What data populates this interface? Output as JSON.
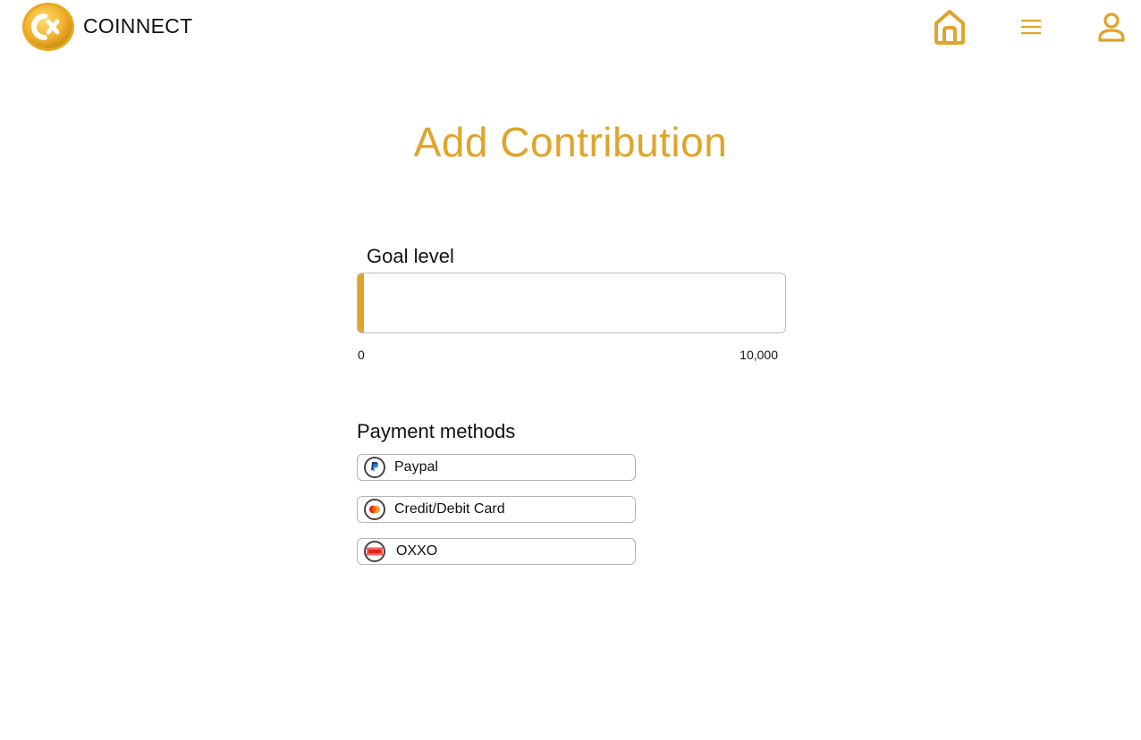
{
  "app": {
    "brand_name": "COINNECT",
    "accent_color": "#e0a42b"
  },
  "nav": {
    "icons": [
      "home-icon",
      "menu-icon",
      "profile-icon"
    ]
  },
  "page": {
    "title": "Add Contribution"
  },
  "goal": {
    "label": "Goal level",
    "min_label": "0",
    "max_label": "10,000",
    "progress_fraction": 0.015
  },
  "payment": {
    "label": "Payment methods",
    "methods": [
      {
        "label": "Paypal",
        "icon": "paypal-icon"
      },
      {
        "label": "Credit/Debit Card",
        "icon": "mastercard-icon"
      },
      {
        "label": "OXXO",
        "icon": "oxxo-icon"
      }
    ]
  }
}
